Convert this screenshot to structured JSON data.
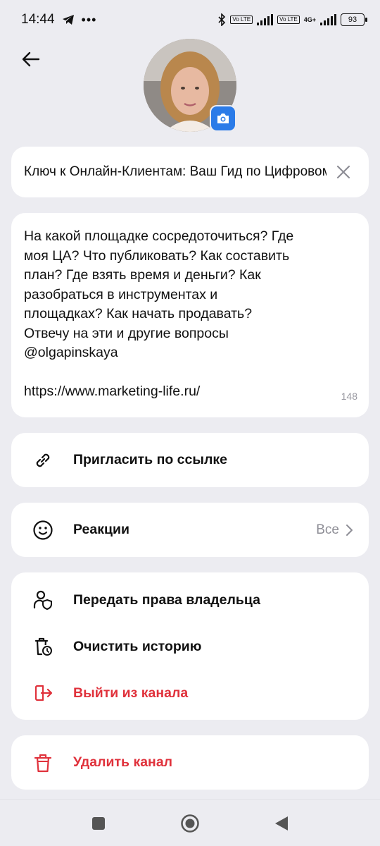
{
  "status_bar": {
    "time": "14:44",
    "battery": "93",
    "network_tag1": "Vo LTE",
    "network_tag2": "4G+"
  },
  "icons": {
    "back": "arrow-left-icon",
    "camera": "camera-icon",
    "clear": "close-icon",
    "link": "link-icon",
    "smile": "smile-icon",
    "transfer": "user-shield-icon",
    "clear_history": "trash-clock-icon",
    "leave": "exit-icon",
    "delete": "trash-icon",
    "chevron": "chevron-right-icon"
  },
  "channel": {
    "title_value": "Ключ к Онлайн-Клиентам: Ваш Гид по Цифровому Маркетингу",
    "description": "На какой площадке сосредоточиться? Где\nмоя ЦА? Что публиковать? Как составить\nплан? Где взять время и деньги? Как\nразобраться в инструментах и\nплощадках? Как начать продавать?\nОтвечу на эти и другие вопросы\n@olgapinskaya\n\nhttps://www.marketing-life.ru/",
    "description_counter": "148"
  },
  "menu": {
    "invite_label": "Пригласить по ссылке",
    "reactions_label": "Реакции",
    "reactions_value": "Все",
    "transfer_label": "Передать права владельца",
    "clear_history_label": "Очистить историю",
    "leave_label": "Выйти из канала",
    "delete_label": "Удалить канал"
  },
  "colors": {
    "accent": "#2b7be8",
    "danger": "#e0323c",
    "background": "#ececf1",
    "card": "#ffffff"
  }
}
